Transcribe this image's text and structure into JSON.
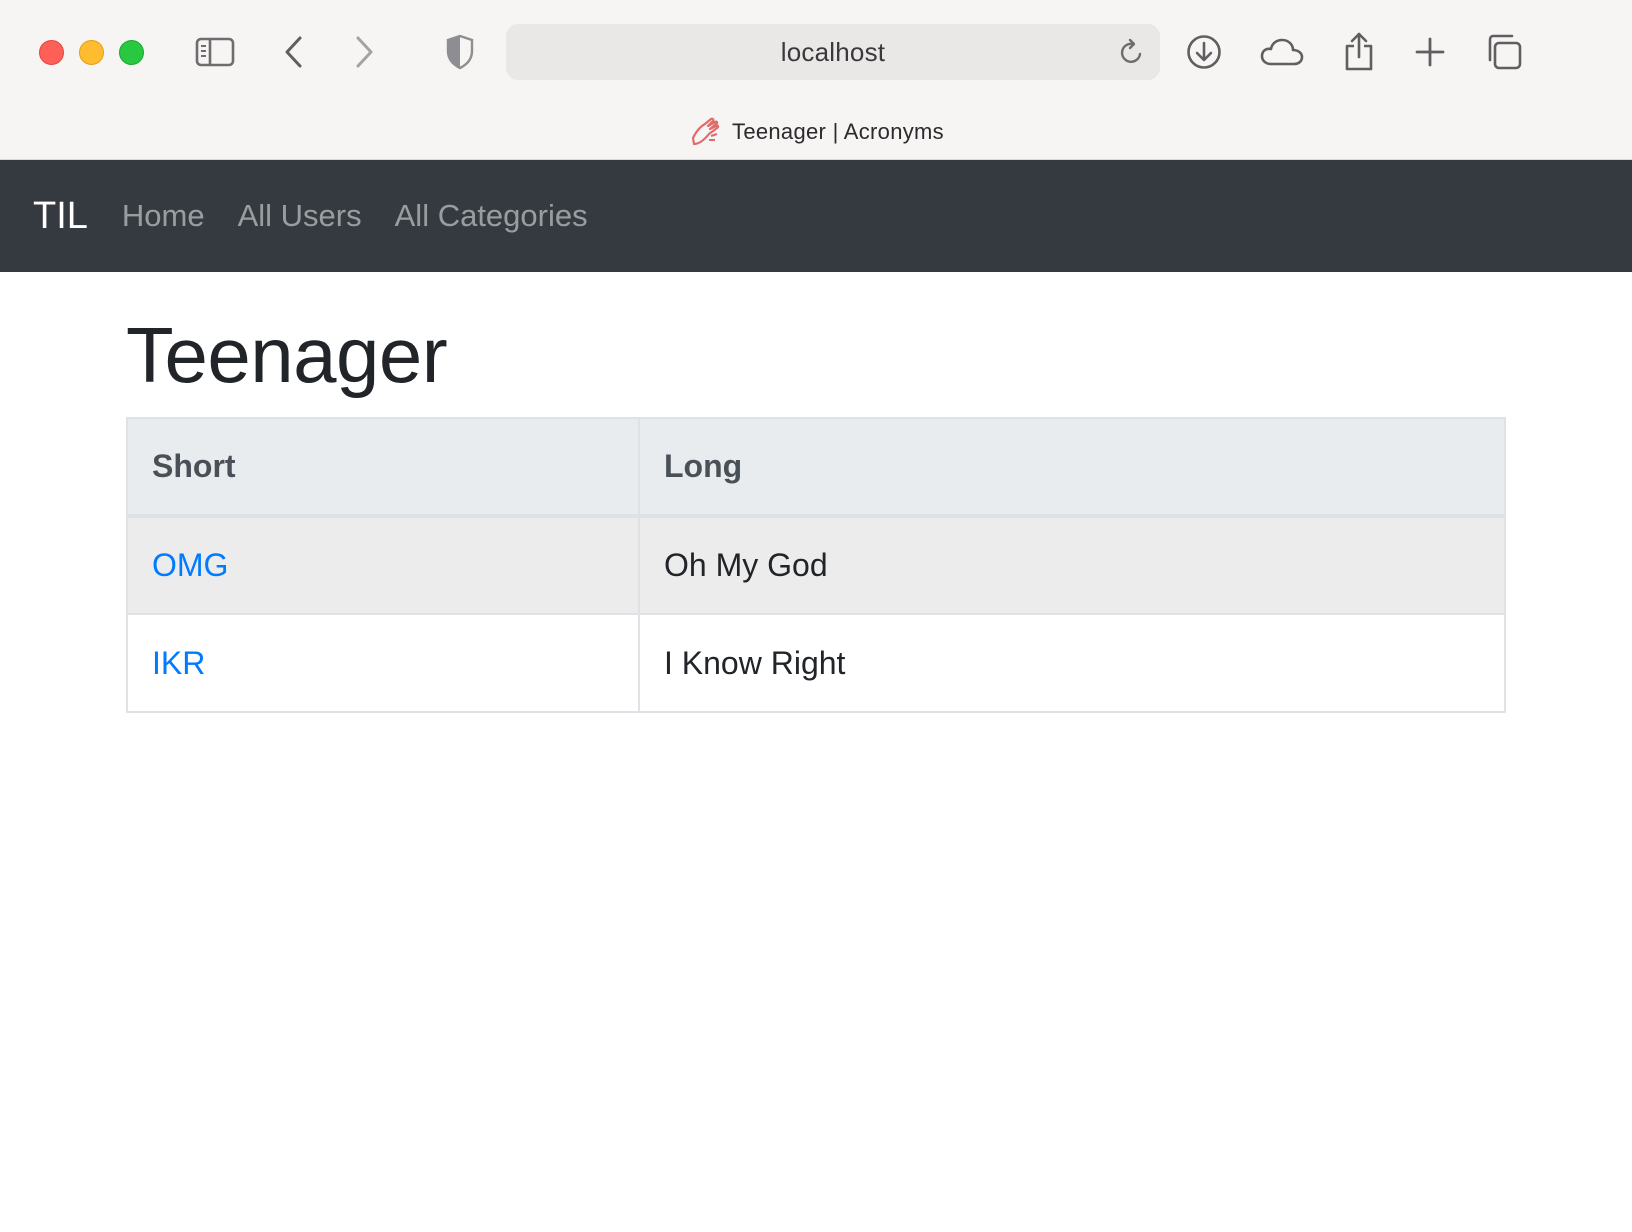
{
  "browser": {
    "address": "localhost",
    "tab_title": "Teenager | Acronyms",
    "colors": {
      "close": "#fe5f57",
      "minimize": "#febc2e",
      "maximize": "#28c840"
    },
    "toolbar_icons": [
      "sidebar-icon",
      "back-icon",
      "forward-icon",
      "shield-icon",
      "reload-icon",
      "download-icon",
      "cloud-icon",
      "share-icon",
      "plus-icon",
      "tabs-icon"
    ]
  },
  "navbar": {
    "brand": "TIL",
    "links": [
      {
        "label": "Home"
      },
      {
        "label": "All Users"
      },
      {
        "label": "All Categories"
      }
    ],
    "background": "#343a40"
  },
  "page": {
    "title": "Teenager",
    "table": {
      "headers": [
        "Short",
        "Long"
      ],
      "rows": [
        {
          "short": "OMG",
          "long": "Oh My God"
        },
        {
          "short": "IKR",
          "long": "I Know Right"
        }
      ]
    },
    "link_color": "#007bff"
  }
}
